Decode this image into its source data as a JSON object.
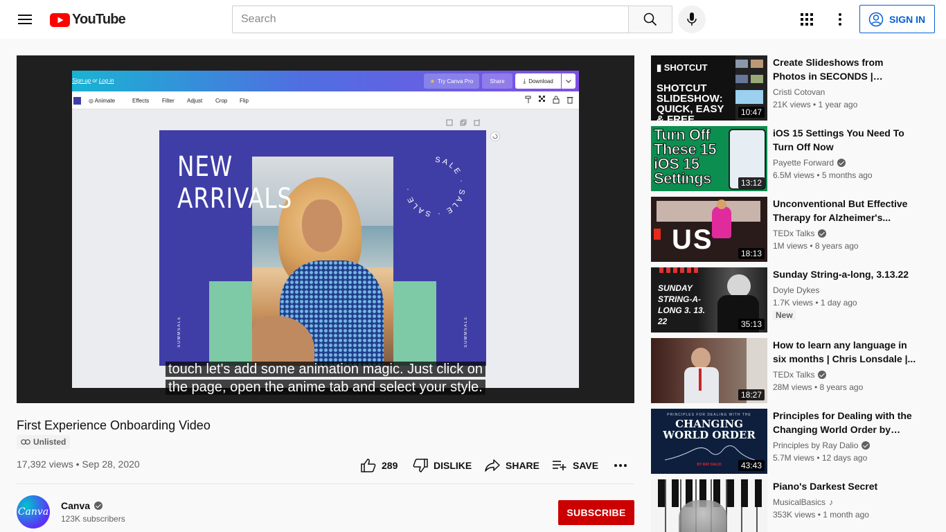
{
  "header": {
    "logo_text": "YouTube",
    "search_placeholder": "Search",
    "sign_in_label": "SIGN IN"
  },
  "player": {
    "editor": {
      "signup_text_a": "Sign up",
      "signup_text_or": " or ",
      "signup_text_b": "Log in",
      "try_pro_label": "Try Canva Pro",
      "share_label": "Share",
      "download_label": "Download",
      "tools": [
        "Animate",
        "Effects",
        "Filter",
        "Adjust",
        "Crop",
        "Flip"
      ]
    },
    "design": {
      "headline_line1": "NEW",
      "headline_line2": "ARRIVALS",
      "ring_text": "SALE · SALE · SALE · ",
      "side_text": "SUMMSALE"
    },
    "caption_line1": "touch let's add some animation magic. Just click on",
    "caption_line2": "the page, open the anime tab and select your style."
  },
  "video": {
    "title": "First Experience Onboarding Video",
    "unlisted_label": "Unlisted",
    "views_line": "17,392 views • Sep 28, 2020",
    "like_count": "289",
    "dislike_label": "DISLIKE",
    "share_label": "SHARE",
    "save_label": "SAVE"
  },
  "channel": {
    "avatar_text": "Canva",
    "name": "Canva",
    "subscribers": "123K subscribers",
    "subscribe_label": "SUBSCRIBE"
  },
  "recommendations": [
    {
      "title": "Create Slideshows from Photos in SECONDS | Quickest, Easiest...",
      "channel": "Cristi Cotovan",
      "verified": false,
      "meta": "21K views • 1 year ago",
      "duration": "10:47",
      "thumb_text": "SHOTCUT SLIDESHOW: QUICK, EASY & FREE"
    },
    {
      "title": "iOS 15 Settings You Need To Turn Off Now",
      "channel": "Payette Forward",
      "verified": true,
      "meta": "6.5M views • 5 months ago",
      "duration": "13:12",
      "thumb_text": "Turn Off These 15 iOS 15 Settings"
    },
    {
      "title": "Unconventional But Effective Therapy for Alzheimer's...",
      "channel": "TEDx Talks",
      "verified": true,
      "meta": "1M views • 8 years ago",
      "duration": "18:13",
      "thumb_text": "US"
    },
    {
      "title": "Sunday String-a-long, 3.13.22",
      "channel": "Doyle Dykes",
      "verified": false,
      "meta": "1.7K views • 1 day ago",
      "duration": "35:13",
      "badge": "New",
      "thumb_text": "SUNDAY STRING-A-LONG 3. 13. 22"
    },
    {
      "title": "How to learn any language in six months | Chris Lonsdale |...",
      "channel": "TEDx Talks",
      "verified": true,
      "meta": "28M views • 8 years ago",
      "duration": "18:27"
    },
    {
      "title": "Principles for Dealing with the Changing World Order by Ray...",
      "channel": "Principles by Ray Dalio",
      "verified": true,
      "meta": "5.7M views • 12 days ago",
      "duration": "43:43",
      "thumb_text_top": "PRINCIPLES FOR DEALING WITH THE",
      "thumb_text": "CHANGING WORLD ORDER",
      "thumb_text_bottom": "BY RAY DALIO"
    },
    {
      "title": "Piano's Darkest Secret",
      "channel": "MusicalBasics",
      "verified": false,
      "music": true,
      "meta": "353K views • 1 month ago",
      "duration": ""
    }
  ],
  "colors": {
    "brand_red": "#ff0000",
    "subscribe_red": "#cc0000",
    "link_blue": "#065fd4",
    "canva_purple": "#3f3ea6",
    "canva_green": "#7ec9a6"
  }
}
